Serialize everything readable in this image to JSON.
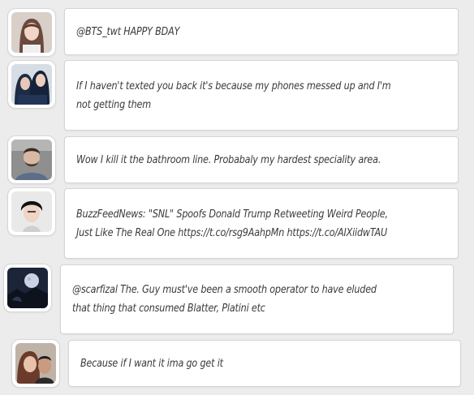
{
  "feed": {
    "items": [
      {
        "avatar": "avatar-woman-long-hair",
        "text": "@BTS_twt HAPPY BDAY"
      },
      {
        "avatar": "avatar-two-women",
        "text": "If I haven't texted you back it's because my phones messed up and I'm not getting them"
      },
      {
        "avatar": "avatar-man-beard",
        "text": "Wow I kill it the bathroom line. Probabaly my hardest speciality area."
      },
      {
        "avatar": "avatar-man-dark-hair",
        "text": "BuzzFeedNews: \"SNL\" Spoofs Donald Trump Retweeting Weird People, Just Like The Real One https://t.co/rsg9AahpMn https://t.co/AIXiidwTAU"
      },
      {
        "avatar": "avatar-moon-night",
        "text": "@scarfizal The. Guy must've been a smooth operator to have eluded that thing that consumed Blatter, Platini etc"
      },
      {
        "avatar": "avatar-couple-selfie",
        "text": "Because if I want it ima go get it"
      }
    ]
  },
  "colors": {
    "background": "#ececec",
    "bubble": "#ffffff",
    "border": "#d4d4d4",
    "text": "#3a3a3a"
  }
}
